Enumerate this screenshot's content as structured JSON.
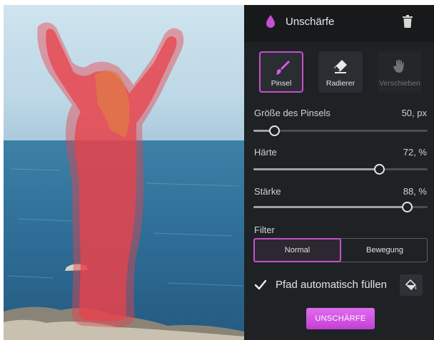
{
  "header": {
    "title": "Unschärfe",
    "icon": "drop-icon",
    "trash_icon": "trash-icon"
  },
  "tools": [
    {
      "label": "Pinsel",
      "icon": "brush-icon",
      "active": true
    },
    {
      "label": "Radierer",
      "icon": "eraser-icon",
      "active": false
    },
    {
      "label": "Verschieben",
      "icon": "hand-icon",
      "active": false,
      "disabled": true
    }
  ],
  "sliders": [
    {
      "label": "Größe des Pinsels",
      "value_text": "50, px",
      "fraction": 0.12
    },
    {
      "label": "Härte",
      "value_text": "72, %",
      "fraction": 0.72
    },
    {
      "label": "Stärke",
      "value_text": "88, %",
      "fraction": 0.88
    }
  ],
  "filter": {
    "label": "Filter",
    "options": [
      "Normal",
      "Bewegung"
    ],
    "selected": "Normal"
  },
  "auto_fill": {
    "label": "Pfad automatisch füllen",
    "checked": true,
    "button_icon": "paint-bucket-icon"
  },
  "action": {
    "label": "UNSCHÄRFE"
  },
  "colors": {
    "accent": "#c64fd0",
    "panel_bg": "#1f2225",
    "header_bg": "#17191b",
    "mask": "#e8434b"
  }
}
